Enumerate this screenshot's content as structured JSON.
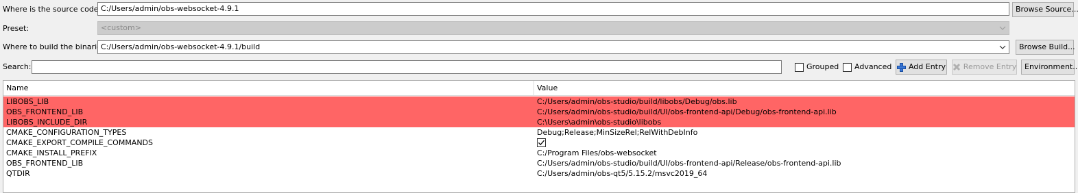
{
  "source": {
    "label": "Where is the source code:",
    "value": "C:/Users/admin/obs-websocket-4.9.1",
    "browse": "Browse Source..."
  },
  "preset": {
    "label": "Preset:",
    "value": "<custom>"
  },
  "build": {
    "label": "Where to build the binaries:",
    "value": "C:/Users/admin/obs-websocket-4.9.1/build",
    "browse": "Browse Build..."
  },
  "search": {
    "label": "Search:",
    "value": ""
  },
  "options": {
    "grouped": "Grouped",
    "advanced": "Advanced",
    "add_entry": "Add Entry",
    "remove_entry": "Remove Entry",
    "environment": "Environment..."
  },
  "table": {
    "headers": {
      "name": "Name",
      "value": "Value"
    },
    "rows": [
      {
        "name": "LIBOBS_LIB",
        "value": "C:/Users/admin/obs-studio/build/libobs/Debug/obs.lib",
        "highlight": true
      },
      {
        "name": "OBS_FRONTEND_LIB",
        "value": "C:/Users/admin/obs-studio/build/UI/obs-frontend-api/Debug/obs-frontend-api.lib",
        "highlight": true
      },
      {
        "name": "LIBOBS_INCLUDE_DIR",
        "value": "C:\\Users\\admin\\obs-studio\\libobs",
        "highlight": true
      },
      {
        "name": "CMAKE_CONFIGURATION_TYPES",
        "value": "Debug;Release;MinSizeRel;RelWithDebInfo",
        "highlight": false
      },
      {
        "name": "CMAKE_EXPORT_COMPILE_COMMANDS",
        "value": "",
        "checked": true,
        "highlight": false
      },
      {
        "name": "CMAKE_INSTALL_PREFIX",
        "value": "C:/Program Files/obs-websocket",
        "highlight": false
      },
      {
        "name": "OBS_FRONTEND_LIB",
        "value": "C:/Users/admin/obs-studio/build/UI/obs-frontend-api/Release/obs-frontend-api.lib",
        "highlight": false
      },
      {
        "name": "QTDIR",
        "value": "C:/Users/admin/obs-qt5/5.15.2/msvc2019_64",
        "highlight": false
      }
    ]
  },
  "colors": {
    "highlight_row": "#ff6565",
    "add_icon": "#1a5fc8"
  },
  "icons": {
    "add": "plus-icon",
    "remove": "x-icon",
    "dropdown": "chevron-down-icon"
  }
}
